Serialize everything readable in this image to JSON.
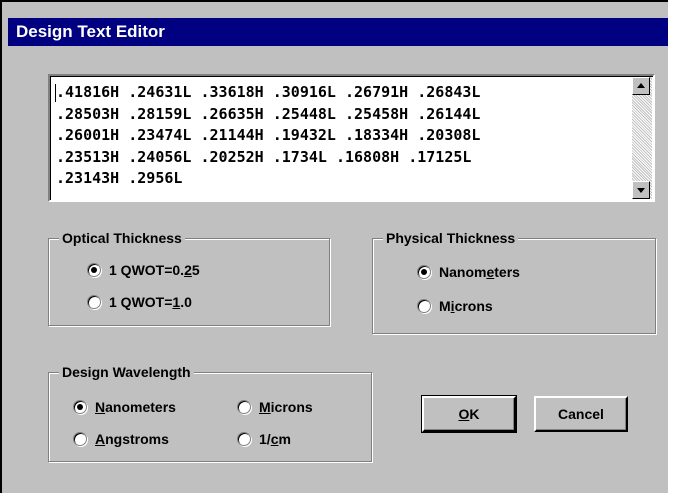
{
  "window": {
    "title": "Design Text Editor"
  },
  "editor": {
    "lines": [
      ".41816H .24631L .33618H .30916L .26791H .26843L",
      ".28503H .28159L .26635H .25448L .25458H .26144L",
      ".26001H .23474L .21144H .19432L .18334H .20308L",
      ".23513H .24056L .20252H .1734L .16808H .17125L",
      ".23143H .2956L"
    ]
  },
  "optical": {
    "title": "Optical Thickness",
    "o1": {
      "pre": "1 QWOT=0.",
      "u": "2",
      "post": "5",
      "selected": true
    },
    "o2": {
      "pre": "1 QWOT=",
      "u": "1",
      "post": ".0",
      "selected": false
    }
  },
  "physical": {
    "title": "Physical Thickness",
    "o1": {
      "pre": "Nanom",
      "u": "e",
      "post": "ters",
      "selected": true
    },
    "o2": {
      "pre": "M",
      "u": "i",
      "post": "crons",
      "selected": false
    }
  },
  "wavelength": {
    "title": "Design Wavelength",
    "nm": {
      "pre": "",
      "u": "N",
      "post": "anometers",
      "selected": true
    },
    "mic": {
      "pre": "",
      "u": "M",
      "post": "icrons",
      "selected": false
    },
    "ang": {
      "pre": "",
      "u": "A",
      "post": "ngstroms",
      "selected": false
    },
    "cm": {
      "pre": "1/",
      "u": "c",
      "post": "m",
      "selected": false
    }
  },
  "buttons": {
    "ok": {
      "u": "O",
      "post": "K"
    },
    "cancel": "Cancel"
  }
}
